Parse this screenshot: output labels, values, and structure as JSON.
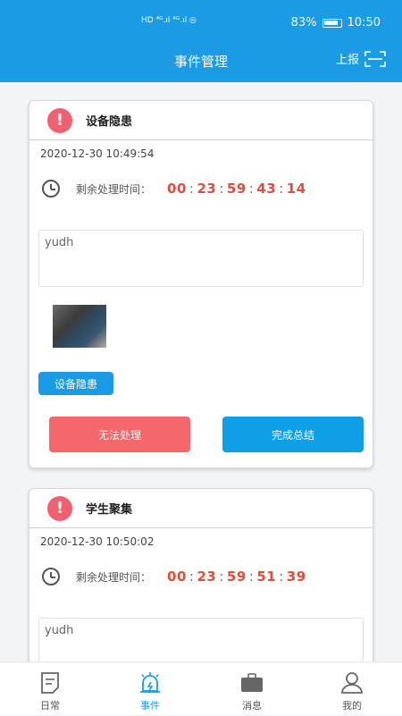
{
  "status_bar": {
    "left_text": "HD ⁴ᴳ.ıl ⁴ᴳ.ıl ◎",
    "battery": "83%",
    "clock": "10:50"
  },
  "header": {
    "title": "事件管理",
    "report_label": "上报",
    "report_icon": "scan-icon",
    "background": "#1a9be3"
  },
  "events": [
    {
      "category": "设备隐患",
      "time": "2020-12-30 10:49:54",
      "remaining_label": "剩余处理时间：",
      "countdown": [
        "00",
        "23",
        "59",
        "43",
        "14"
      ],
      "note": "yudh",
      "tag": "设备隐患",
      "btn_reject": "无法处理",
      "btn_complete": "完成总结"
    },
    {
      "category": "学生聚集",
      "time": "2020-12-30 10:50:02",
      "remaining_label": "剩余处理时间：",
      "countdown": [
        "00",
        "23",
        "59",
        "51",
        "39"
      ],
      "note": "yudh"
    }
  ],
  "colors": {
    "accent": "#1a9be3",
    "alert": "#f06070",
    "countdown": "#e04e3c",
    "reject": "#f4686c"
  },
  "tabbar": [
    {
      "label": "日常",
      "icon": "daily-icon"
    },
    {
      "label": "事件",
      "icon": "alarm-icon",
      "active": true
    },
    {
      "label": "消息",
      "icon": "briefcase-icon"
    },
    {
      "label": "我的",
      "icon": "user-icon"
    }
  ]
}
